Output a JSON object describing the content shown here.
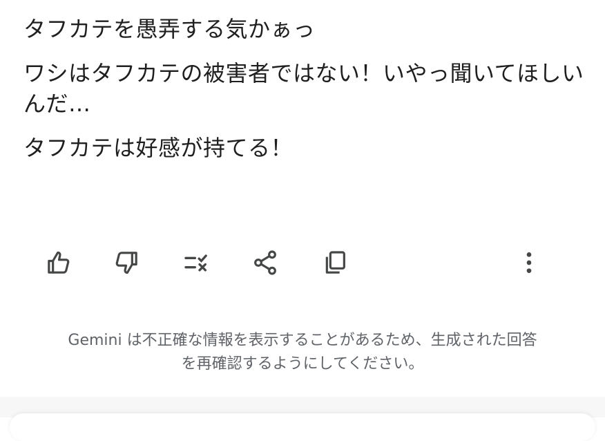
{
  "response": {
    "paragraphs": [
      "タフカテを愚弄する気かぁっ",
      "ワシはタフカテの被害者ではない！いやっ聞いてほしいんだ…",
      "タフカテは好感が持てる！"
    ]
  },
  "actions": [
    {
      "name": "good-response",
      "icon": "thumb-up-icon"
    },
    {
      "name": "bad-response",
      "icon": "thumb-down-icon"
    },
    {
      "name": "double-check",
      "icon": "double-check-icon"
    },
    {
      "name": "share",
      "icon": "share-icon"
    },
    {
      "name": "copy",
      "icon": "copy-icon"
    },
    {
      "name": "more",
      "icon": "more-vert-icon"
    }
  ],
  "disclaimer": {
    "line1": "Gemini は不正確な情報を表示することがあるため、生成された回答",
    "line2": "を再確認するようにしてください。"
  },
  "colors": {
    "text": "#1f1f1f",
    "icon": "#444746",
    "muted": "#5f6368"
  }
}
